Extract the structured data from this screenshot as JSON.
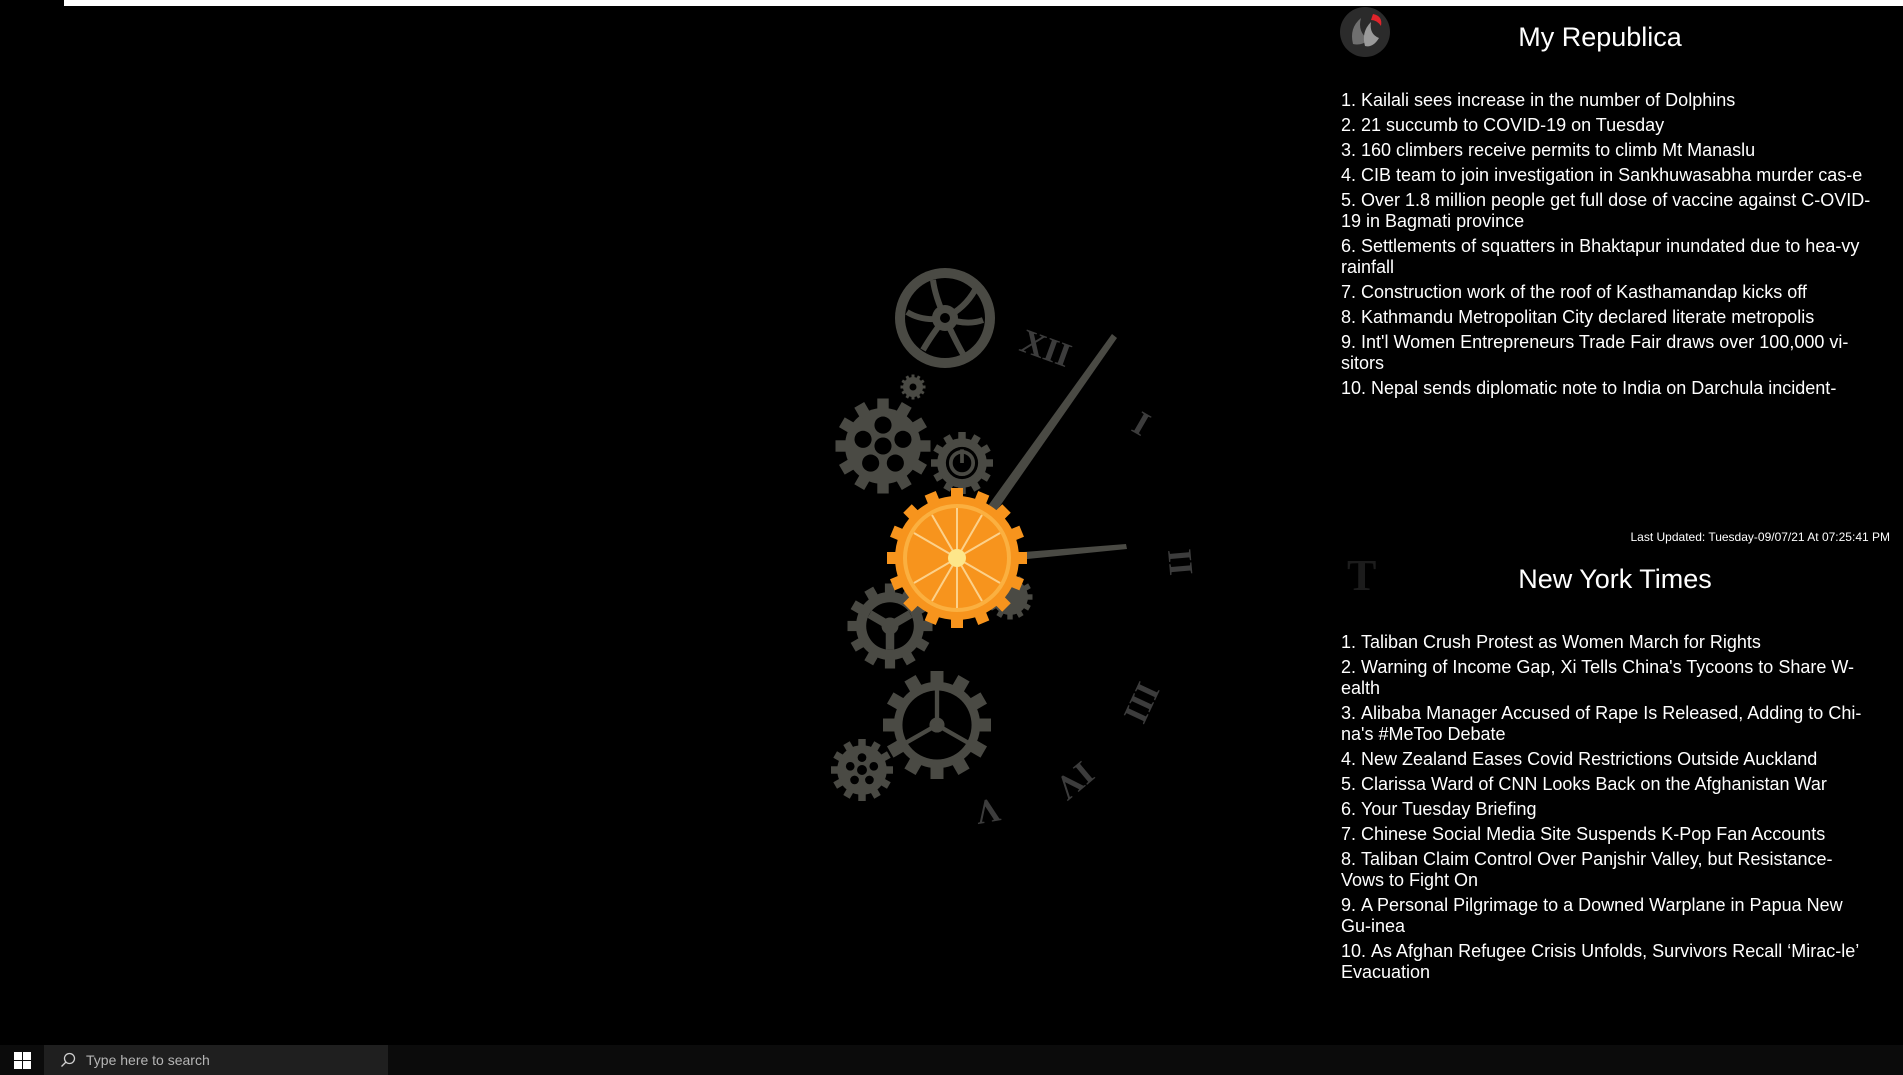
{
  "republica": {
    "title": "My Republica",
    "logo": "republica-logo",
    "headlines": [
      "Kailali sees increase in the number of Dolphins",
      "21 succumb to COVID-19 on Tuesday",
      "160 climbers receive permits to climb Mt Manaslu",
      "CIB team to join investigation in Sankhuwasabha murder cas-e",
      "Over 1.8 million people get full dose of vaccine against C-OVID-19 in Bagmati province",
      "Settlements of squatters in Bhaktapur inundated due to hea-vy rainfall",
      "Construction work of the roof of Kasthamandap kicks off",
      "Kathmandu Metropolitan City declared literate metropolis",
      "Int'l Women Entrepreneurs Trade Fair draws over 100,000 vi-sitors",
      "Nepal sends diplomatic note to India on Darchula incident-"
    ]
  },
  "last_updated": "Last Updated: Tuesday-09/07/21 At 07:25:41 PM",
  "nyt": {
    "title": "New York Times",
    "logo": "nyt-logo",
    "headlines": [
      "Taliban Crush Protest as Women March for Rights",
      "Warning of Income Gap, Xi Tells China's Tycoons to Share W-ealth",
      "Alibaba Manager Accused of Rape Is Released, Adding to Chi-na's #MeToo Debate",
      "New Zealand Eases Covid Restrictions Outside Auckland",
      "Clarissa Ward of CNN Looks Back on the Afghanistan War",
      "Your Tuesday Briefing",
      "Chinese Social Media Site Suspends K-Pop Fan Accounts",
      "Taliban Claim Control Over Panjshir Valley, but Resistance- Vows to Fight On",
      "A Personal Pilgrimage to a Downed Warplane in Papua New Gu-inea",
      "As Afghan Refugee Crisis Unfolds, Survivors Recall ‘Mirac-le’ Evacuation"
    ]
  },
  "clock": {
    "numerals": [
      "XII",
      "I",
      "II",
      "III",
      "IV",
      "V"
    ],
    "hour_hand_icon": "clock-hour-hand",
    "center_icon": "orange-slice-gear-icon",
    "colors": {
      "gear": "#4a4a44",
      "accent": "#f7941d",
      "accent_light": "#fbb040",
      "numeral": "#3c3c3c"
    }
  },
  "taskbar": {
    "start_icon": "windows-icon",
    "search_placeholder": "Type here to search"
  }
}
